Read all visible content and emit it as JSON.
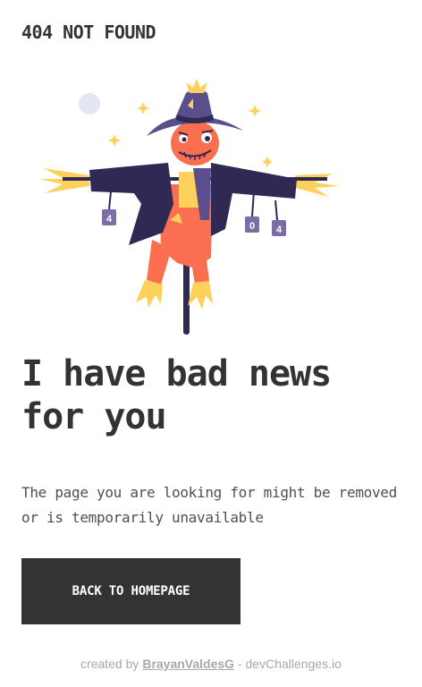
{
  "header": {
    "brand": "404 NOT FOUND"
  },
  "illustration": {
    "icon": "scarecrow-icon",
    "can_labels": [
      "4",
      "0",
      "4"
    ]
  },
  "main": {
    "headline": "I have bad news for you",
    "description": "The page you are looking for might be removed or is temporarily unavailable",
    "cta_label": "BACK TO HOMEPAGE"
  },
  "footer": {
    "prefix": "created by ",
    "author": "BrayanValdesG",
    "separator": " - ",
    "site": "devChallenges.io"
  },
  "colors": {
    "text": "#333333",
    "button_bg": "#333333",
    "button_text": "#ffffff",
    "muted": "#a9a9a9",
    "hat_purple": "#5b4e8c",
    "coat_navy": "#2f2954",
    "body_orange": "#f96f4f",
    "straw_yellow": "#fdd15b"
  }
}
